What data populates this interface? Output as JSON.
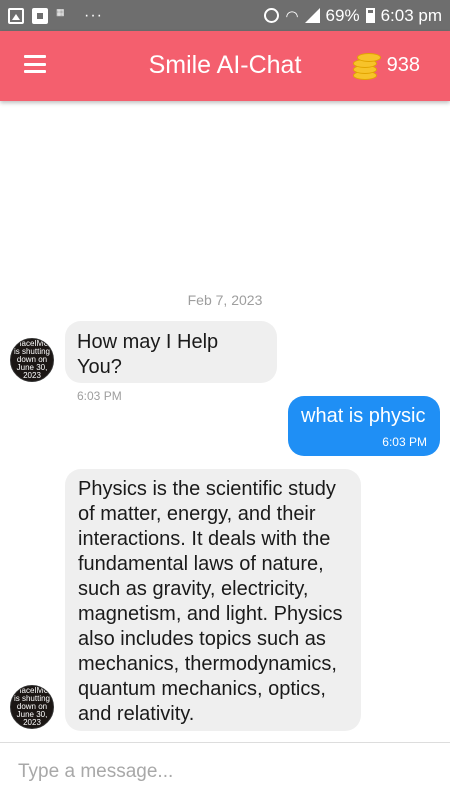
{
  "statusbar": {
    "dots": "···",
    "battery": "69%",
    "time": "6:03 pm",
    "bg_color": "#6e6e6e"
  },
  "header": {
    "title": "Smile AI-Chat",
    "coin_count": "938",
    "bg_color": "#f45f6e"
  },
  "chat": {
    "date_separator": "Feb 7, 2023",
    "avatar_text": "PlaceIMG is shutting down on June 30, 2023",
    "messages": [
      {
        "sender": "bot",
        "text": "How may I Help You?",
        "time": "6:03 PM"
      },
      {
        "sender": "user",
        "text": "what is physic",
        "time": "6:03 PM"
      },
      {
        "sender": "bot",
        "text": "Physics is the scientific study of matter, energy, and their interactions. It deals with the fundamental laws of nature, such as gravity, electricity, magnetism, and light. Physics also includes topics such as mechanics, thermodynamics, quantum mechanics, optics, and relativity.",
        "time": ""
      }
    ]
  },
  "composer": {
    "placeholder": "Type a message..."
  }
}
